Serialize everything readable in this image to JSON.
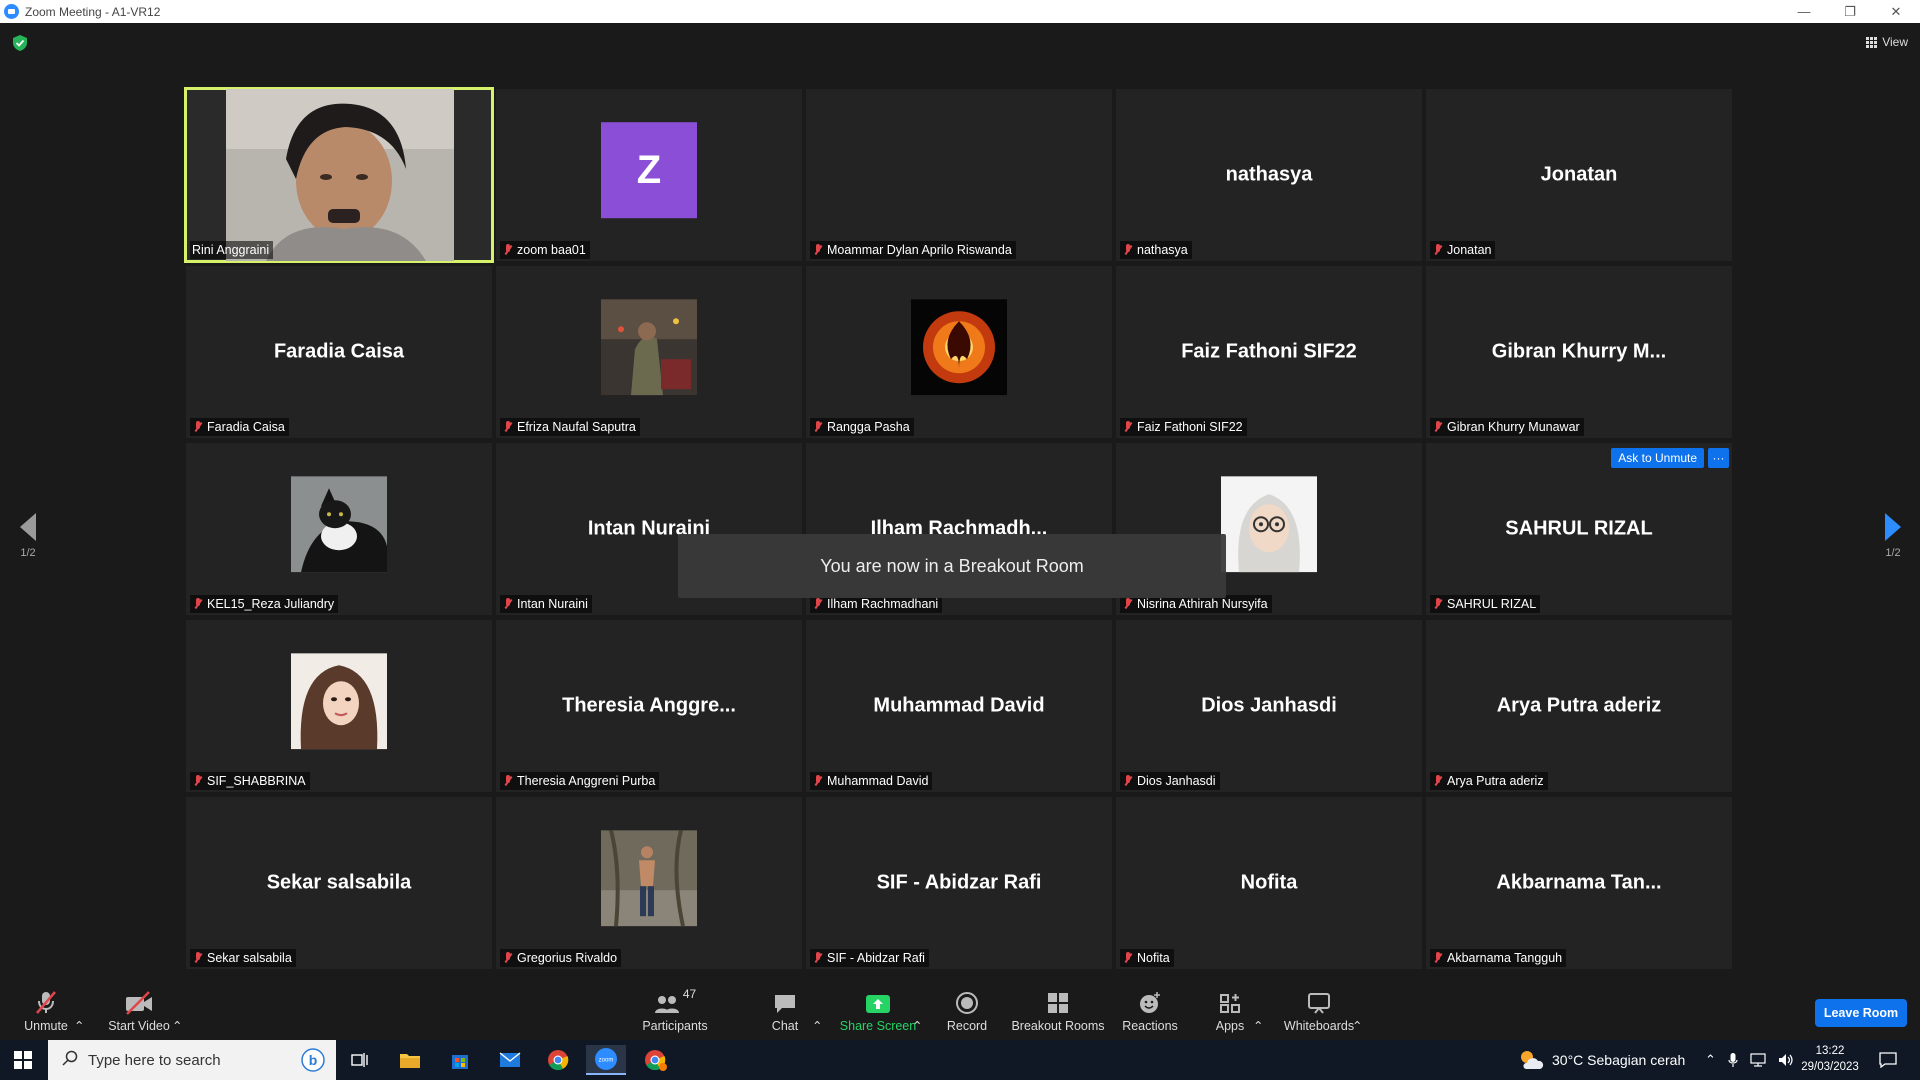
{
  "window": {
    "title": "Zoom Meeting - A1-VR12"
  },
  "header": {
    "view_label": "View"
  },
  "pager": {
    "left": "1/2",
    "right": "1/2"
  },
  "participants": [
    {
      "big": "",
      "label": "Rini Anggraini",
      "kind": "camera",
      "muted": false,
      "active": true
    },
    {
      "big": "",
      "label": "zoom baa01",
      "kind": "z-avatar",
      "initial": "Z",
      "muted": true
    },
    {
      "big": "",
      "label": "Moammar Dylan Aprilo Riswanda",
      "kind": "blank",
      "muted": true
    },
    {
      "big": "nathasya",
      "label": "nathasya",
      "kind": "name",
      "muted": true
    },
    {
      "big": "Jonatan",
      "label": "Jonatan",
      "kind": "name",
      "muted": true
    },
    {
      "big": "Faradia Caisa",
      "label": "Faradia Caisa",
      "kind": "name",
      "muted": true
    },
    {
      "big": "",
      "label": "Efriza Naufal Saputra",
      "kind": "photo-street",
      "muted": true
    },
    {
      "big": "",
      "label": "Rangga Pasha",
      "kind": "photo-phoenix",
      "muted": true
    },
    {
      "big": "Faiz Fathoni SIF22",
      "label": "Faiz Fathoni SIF22",
      "kind": "name",
      "muted": true
    },
    {
      "big": "Gibran Khurry M...",
      "label": "Gibran Khurry Munawar",
      "kind": "name",
      "muted": true
    },
    {
      "big": "",
      "label": "KEL15_Reza Juliandry",
      "kind": "photo-cat",
      "muted": true
    },
    {
      "big": "Intan Nuraini",
      "label": "Intan Nuraini",
      "kind": "name",
      "muted": true
    },
    {
      "big": "Ilham Rachmadh...",
      "label": "Ilham Rachmadhani",
      "kind": "name",
      "muted": true
    },
    {
      "big": "",
      "label": "Nisrina Athirah Nursyifa",
      "kind": "photo-hijab-cartoon",
      "muted": true
    },
    {
      "big": "SAHRUL RIZAL",
      "label": "SAHRUL RIZAL",
      "kind": "name-ask",
      "muted": true
    },
    {
      "big": "",
      "label": "SIF_SHABBRINA",
      "kind": "photo-hijab",
      "muted": true
    },
    {
      "big": "Theresia Anggre...",
      "label": "Theresia Anggreni Purba",
      "kind": "name",
      "muted": true
    },
    {
      "big": "Muhammad David",
      "label": "Muhammad David",
      "kind": "name",
      "muted": true
    },
    {
      "big": "Dios Janhasdi",
      "label": "Dios Janhasdi",
      "kind": "name",
      "muted": true
    },
    {
      "big": "Arya Putra aderiz",
      "label": "Arya Putra aderiz",
      "kind": "name",
      "muted": true
    },
    {
      "big": "Sekar salsabila",
      "label": "Sekar salsabila",
      "kind": "name",
      "muted": true
    },
    {
      "big": "",
      "label": "Gregorius Rivaldo",
      "kind": "photo-person",
      "muted": true
    },
    {
      "big": "SIF - Abidzar Rafi",
      "label": "SIF - Abidzar Rafi",
      "kind": "name",
      "muted": true
    },
    {
      "big": "Nofita",
      "label": "Nofita",
      "kind": "name",
      "muted": true
    },
    {
      "big": "Akbarnama Tan...",
      "label": "Akbarnama Tangguh",
      "kind": "name",
      "muted": true
    }
  ],
  "tile_actions": {
    "ask_to_unmute": "Ask to Unmute",
    "more": "···"
  },
  "toast": "You are now in a Breakout Room",
  "toolbar": {
    "unmute": "Unmute",
    "start_video": "Start Video",
    "participants": "Participants",
    "participants_count": "47",
    "chat": "Chat",
    "share_screen": "Share Screen",
    "record": "Record",
    "breakout_rooms": "Breakout Rooms",
    "reactions": "Reactions",
    "apps": "Apps",
    "whiteboards": "Whiteboards",
    "leave": "Leave Room"
  },
  "taskbar": {
    "search_placeholder": "Type here to search",
    "weather": "30°C  Sebagian cerah",
    "time": "13:22",
    "date": "29/03/2023"
  }
}
